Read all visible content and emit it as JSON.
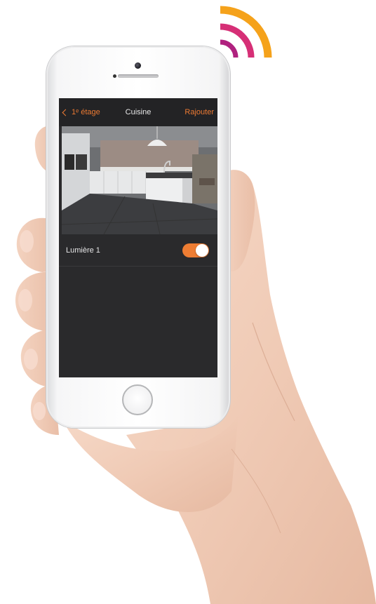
{
  "colors": {
    "accent": "#ec7a33",
    "screen_background": "#2a2a2c",
    "navbar_background": "#232325",
    "wifi_orange": "#f5a21b",
    "wifi_pink": "#d62f76",
    "wifi_purple": "#b0217f"
  },
  "navbar": {
    "back_label": "1ᵉ étage",
    "title": "Cuisine",
    "add_label": "Rajouter",
    "back_icon": "chevron-left-icon"
  },
  "room": {
    "photo": "kitchen-photo"
  },
  "devices": [
    {
      "label": "Lumière 1",
      "state_on": true
    }
  ],
  "decor": {
    "wifi_icon": "wifi-icon",
    "hand": "hand-holding-phone"
  }
}
